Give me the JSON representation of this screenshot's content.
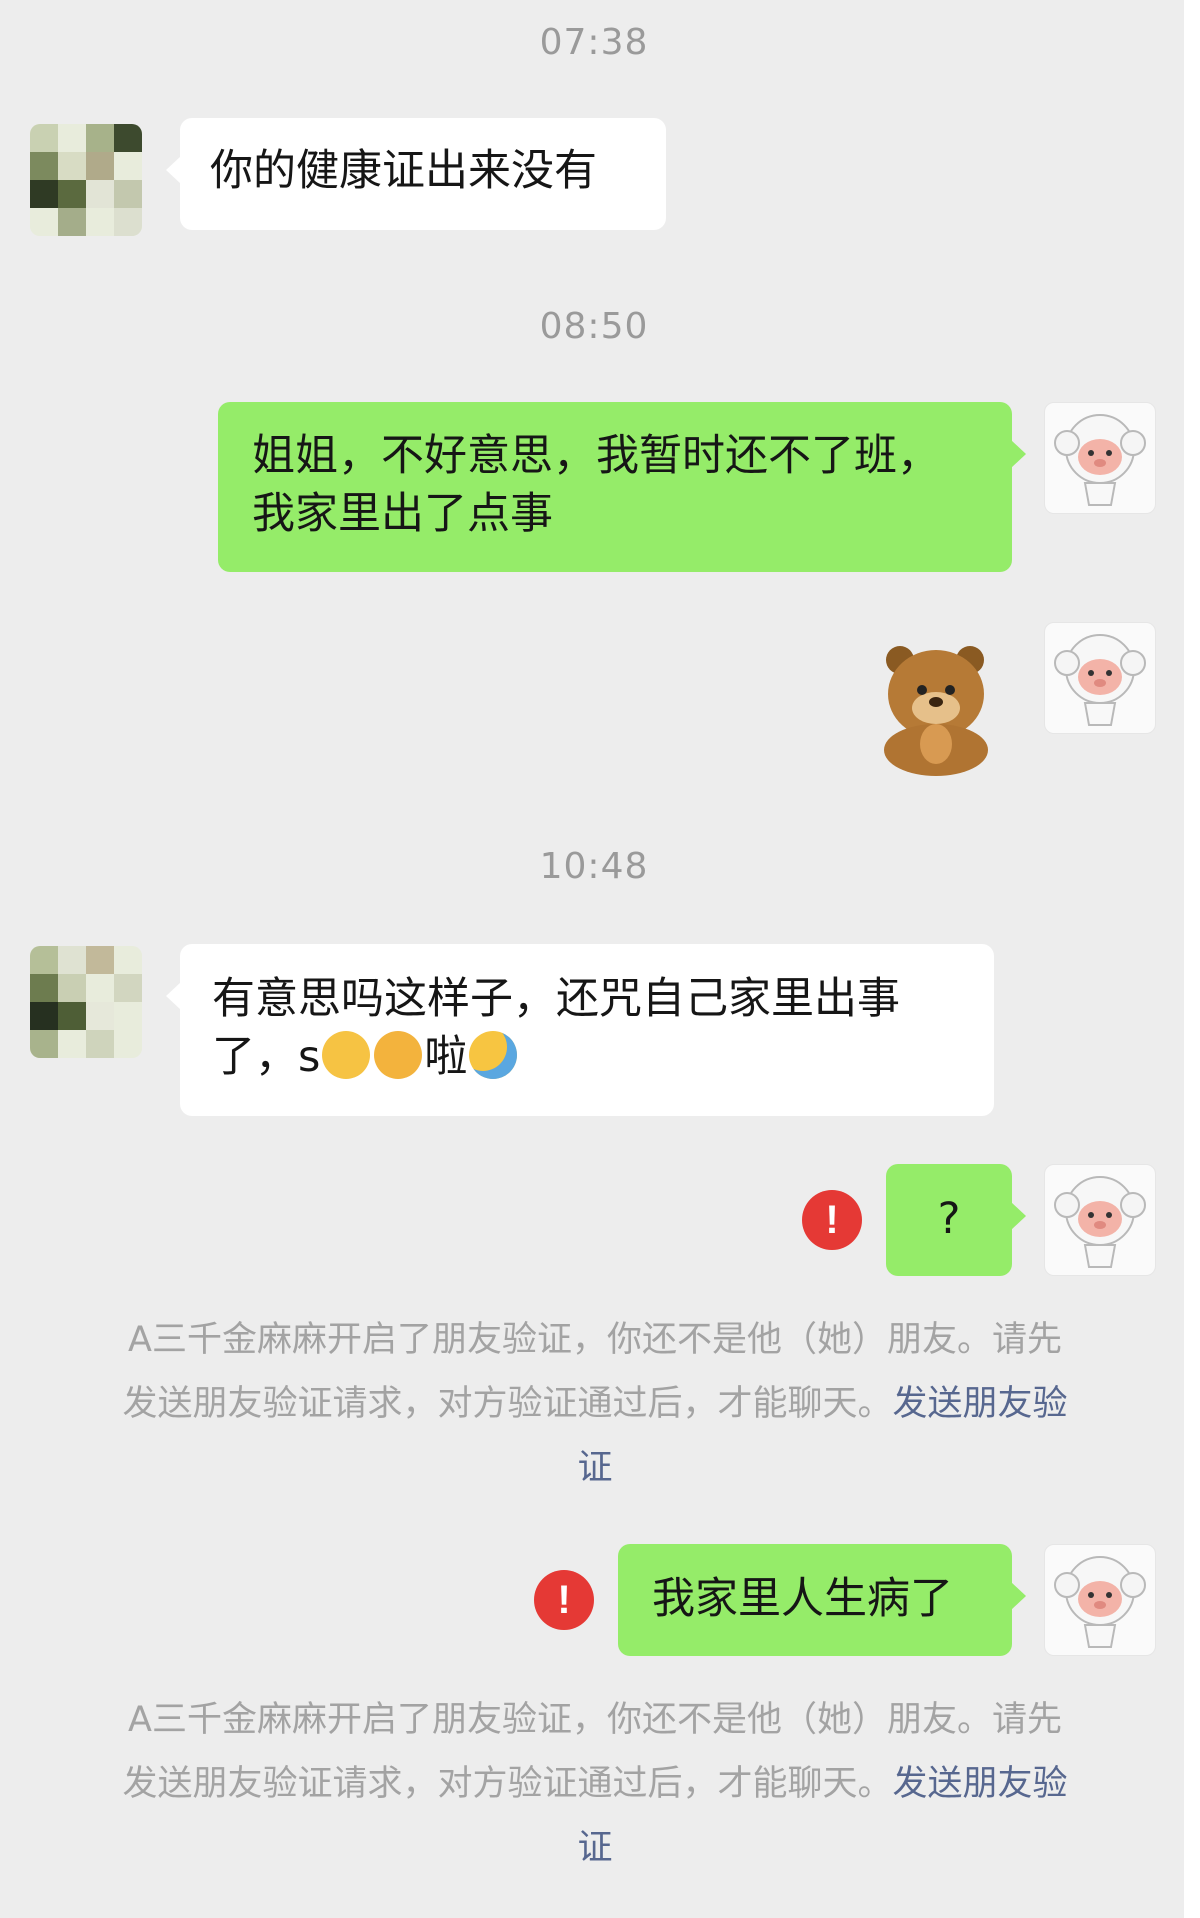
{
  "chat": {
    "time1": "07:38",
    "time2": "08:50",
    "time3": "10:48",
    "msg1": "你的健康证出来没有",
    "msg2_line1": "姐姐，不好意思，我暂时还不了班，",
    "msg2_line2": "我家里出了点事",
    "msg3_line1": "有意思吗这样子，还咒自己家里出事",
    "msg3_line2_start": "了，s",
    "msg3_line2_mid": "啦",
    "msg4": "?",
    "msg5": "我家里人生病了",
    "failed_icon": "!"
  },
  "system_notice": {
    "line1": "A三千金麻麻开启了朋友验证，你还不是他（她）朋友。请先",
    "line2": "发送朋友验证请求，对方验证通过后，才能聊天。",
    "link_part1": "发送朋友验",
    "link_part2": "证"
  },
  "colors": {
    "background": "#ededed",
    "outgoing_bubble": "#95ec69",
    "incoming_bubble": "#ffffff",
    "link": "#57678f",
    "error": "#e53935"
  },
  "icons": [
    "blurred-avatar",
    "cartoon-girl-avatar",
    "bear-praying-sticker",
    "woman-emoji",
    "man-emoji",
    "crying-laughing-emoji",
    "send-failed-icon"
  ]
}
